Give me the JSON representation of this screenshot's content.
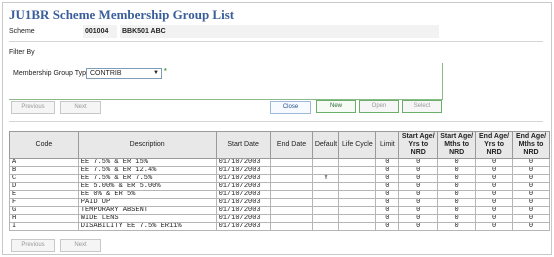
{
  "page": {
    "title": "JU1BR Scheme Membership Group List"
  },
  "scheme": {
    "label": "Scheme",
    "code": "001004",
    "name": "BBK501 ABC"
  },
  "filter": {
    "heading": "Filter By",
    "group_type_label": "Membership Group Type",
    "group_type_value": "CONTRIB",
    "required_marker": "*"
  },
  "buttons": {
    "previous": "Previous",
    "next": "Next",
    "close": "Close",
    "new": "New",
    "open": "Open",
    "select": "Select"
  },
  "table": {
    "headers": {
      "code": "Code",
      "description": "Description",
      "start_date": "Start Date",
      "end_date": "End Date",
      "default": "Default",
      "life_cycle": "Life Cycle",
      "limit": "Limit",
      "start_age_yrs": "Start Age/ Yrs to NRD",
      "start_age_mths": "Start Age/ Mths to NRD",
      "end_age_yrs": "End Age/ Yrs to NRD",
      "end_age_mths": "End Age/ Mths to NRD"
    },
    "rows": [
      {
        "code": "A",
        "description": "EE 7.5% & ER 15%",
        "start_date": "01/10/2003",
        "end_date": "",
        "default": "",
        "life_cycle": "",
        "limit": "0",
        "sa_yrs": "0",
        "sa_mths": "0",
        "ea_yrs": "0",
        "ea_mths": "0"
      },
      {
        "code": "B",
        "description": "EE 7.5% & ER 12.4%",
        "start_date": "01/10/2003",
        "end_date": "",
        "default": "",
        "life_cycle": "",
        "limit": "0",
        "sa_yrs": "0",
        "sa_mths": "0",
        "ea_yrs": "0",
        "ea_mths": "0"
      },
      {
        "code": "C",
        "description": "EE 7.5% & ER 7.5%",
        "start_date": "01/10/2003",
        "end_date": "",
        "default": "Y",
        "life_cycle": "",
        "limit": "0",
        "sa_yrs": "0",
        "sa_mths": "0",
        "ea_yrs": "0",
        "ea_mths": "0"
      },
      {
        "code": "D",
        "description": "EE 5.00% & ER 5.00%",
        "start_date": "01/10/2003",
        "end_date": "",
        "default": "",
        "life_cycle": "",
        "limit": "0",
        "sa_yrs": "0",
        "sa_mths": "0",
        "ea_yrs": "0",
        "ea_mths": "0"
      },
      {
        "code": "E",
        "description": "EE 0% & ER 5%",
        "start_date": "01/10/2003",
        "end_date": "",
        "default": "",
        "life_cycle": "",
        "limit": "0",
        "sa_yrs": "0",
        "sa_mths": "0",
        "ea_yrs": "0",
        "ea_mths": "0"
      },
      {
        "code": "F",
        "description": "PAID UP",
        "start_date": "01/10/2003",
        "end_date": "",
        "default": "",
        "life_cycle": "",
        "limit": "0",
        "sa_yrs": "0",
        "sa_mths": "0",
        "ea_yrs": "0",
        "ea_mths": "0"
      },
      {
        "code": "G",
        "description": "TEMPORARY ABSENT",
        "start_date": "01/10/2003",
        "end_date": "",
        "default": "",
        "life_cycle": "",
        "limit": "0",
        "sa_yrs": "0",
        "sa_mths": "0",
        "ea_yrs": "0",
        "ea_mths": "0"
      },
      {
        "code": "H",
        "description": "WIDE LENS",
        "start_date": "01/10/2003",
        "end_date": "",
        "default": "",
        "life_cycle": "",
        "limit": "0",
        "sa_yrs": "0",
        "sa_mths": "0",
        "ea_yrs": "0",
        "ea_mths": "0"
      },
      {
        "code": "I",
        "description": "DISABILITY  EE 7.5%  ER11%",
        "start_date": "01/10/2003",
        "end_date": "",
        "default": "",
        "life_cycle": "",
        "limit": "0",
        "sa_yrs": "0",
        "sa_mths": "0",
        "ea_yrs": "0",
        "ea_mths": "0"
      }
    ]
  },
  "colors": {
    "title": "#3a5e9a",
    "header_bg": "#e8e8e8",
    "green_border": "#6ab06a"
  }
}
